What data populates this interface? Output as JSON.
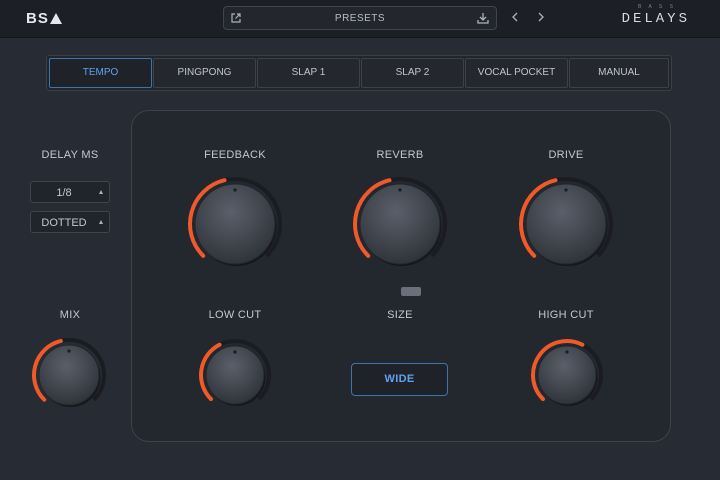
{
  "header": {
    "logo_text": "BS",
    "presets_label": "PRESETS",
    "brand": "DELAYS",
    "brand_sub": "B A S S",
    "icons": [
      "external-link-icon",
      "download-icon",
      "prev-arrow-icon",
      "next-arrow-icon"
    ]
  },
  "tabs": [
    {
      "label": "TEMPO",
      "active": true
    },
    {
      "label": "PINGPONG",
      "active": false
    },
    {
      "label": "SLAP 1",
      "active": false
    },
    {
      "label": "SLAP 2",
      "active": false
    },
    {
      "label": "VOCAL POCKET",
      "active": false
    },
    {
      "label": "MANUAL",
      "active": false
    }
  ],
  "delay": {
    "label": "DELAY MS",
    "division": "1/8",
    "mode": "DOTTED"
  },
  "knobs": {
    "mix": {
      "label": "MIX",
      "value": 0.45
    },
    "feedback": {
      "label": "FEEDBACK",
      "value": 0.45
    },
    "reverb": {
      "label": "REVERB",
      "value": 0.45
    },
    "drive": {
      "label": "DRIVE",
      "value": 0.45
    },
    "low_cut": {
      "label": "LOW CUT",
      "value": 0.4
    },
    "high_cut": {
      "label": "HIGH CUT",
      "value": 0.6
    }
  },
  "size": {
    "label": "SIZE",
    "button": "WIDE"
  },
  "colors": {
    "accent_blue": "#5ea2ee",
    "knob_arc": "#f05a2a",
    "background": "#272b33"
  }
}
